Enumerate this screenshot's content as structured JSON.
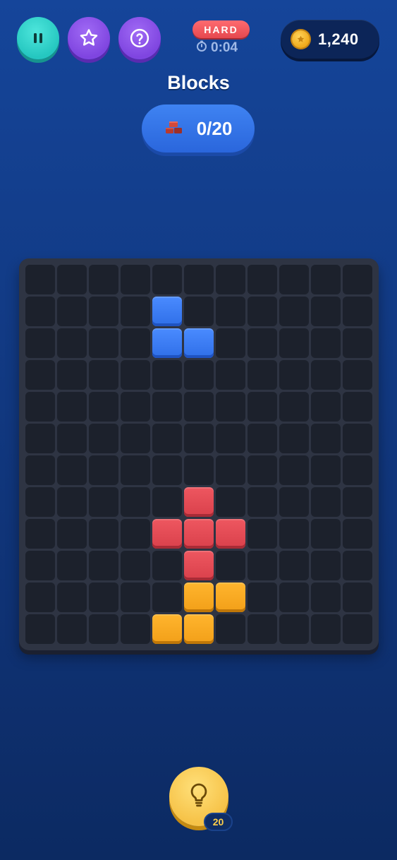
{
  "header": {
    "difficulty": "HARD",
    "timer": "0:04",
    "coins": "1,240",
    "buttons": {
      "pause_icon": "pause-icon",
      "star_icon": "star-icon",
      "help_icon": "question-icon"
    }
  },
  "level": {
    "title": "Blocks",
    "progress": "0/20",
    "progress_icon": "brick-icon"
  },
  "board": {
    "rows": 12,
    "cols": 11,
    "pieces": [
      {
        "color": "blue",
        "cells": [
          [
            1,
            4
          ],
          [
            2,
            4
          ],
          [
            2,
            5
          ]
        ]
      },
      {
        "color": "red",
        "cells": [
          [
            7,
            5
          ],
          [
            8,
            4
          ],
          [
            8,
            5
          ],
          [
            8,
            6
          ],
          [
            9,
            5
          ]
        ]
      },
      {
        "color": "orange",
        "cells": [
          [
            10,
            5
          ],
          [
            10,
            6
          ],
          [
            11,
            4
          ],
          [
            11,
            5
          ]
        ]
      }
    ]
  },
  "hint": {
    "count": "20",
    "icon": "lightbulb-icon"
  },
  "colors": {
    "accent_teal": "#25c7c0",
    "accent_purple": "#7f45e0",
    "difficulty_red": "#e5484f",
    "piece_blue": "#2f6fe8",
    "piece_red": "#d9404b",
    "piece_orange": "#f29f18",
    "hint_gold": "#f6c247"
  }
}
